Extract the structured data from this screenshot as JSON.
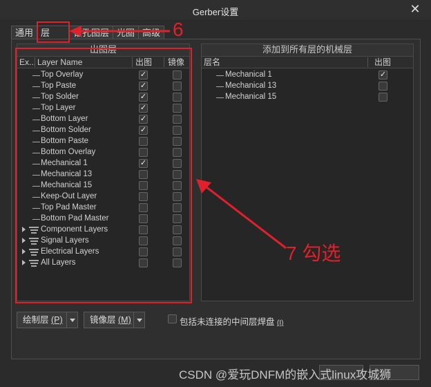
{
  "window": {
    "title": "Gerber设置",
    "close_glyph": "✕"
  },
  "tabs": [
    {
      "label": "通用"
    },
    {
      "label": "层"
    },
    {
      "label": "钻孔图层"
    },
    {
      "label": "光圈"
    },
    {
      "label": "高级"
    }
  ],
  "left_panel": {
    "title": "出图层",
    "headers": {
      "ex": "Ex...",
      "name": "Layer Name",
      "plot": "出图",
      "mirror": "镜像"
    },
    "rows": [
      {
        "name": "Top Overlay",
        "plot": true,
        "mirror": false,
        "kind": "layer"
      },
      {
        "name": "Top Paste",
        "plot": true,
        "mirror": false,
        "kind": "layer"
      },
      {
        "name": "Top Solder",
        "plot": true,
        "mirror": false,
        "kind": "layer"
      },
      {
        "name": "Top Layer",
        "plot": true,
        "mirror": false,
        "kind": "layer"
      },
      {
        "name": "Bottom Layer",
        "plot": true,
        "mirror": false,
        "kind": "layer"
      },
      {
        "name": "Bottom Solder",
        "plot": true,
        "mirror": false,
        "kind": "layer"
      },
      {
        "name": "Bottom Paste",
        "plot": false,
        "mirror": false,
        "kind": "layer"
      },
      {
        "name": "Bottom Overlay",
        "plot": false,
        "mirror": false,
        "kind": "layer"
      },
      {
        "name": "Mechanical 1",
        "plot": true,
        "mirror": false,
        "kind": "layer"
      },
      {
        "name": "Mechanical 13",
        "plot": false,
        "mirror": false,
        "kind": "layer"
      },
      {
        "name": "Mechanical 15",
        "plot": false,
        "mirror": false,
        "kind": "layer"
      },
      {
        "name": "Keep-Out Layer",
        "plot": false,
        "mirror": false,
        "kind": "layer"
      },
      {
        "name": "Top Pad Master",
        "plot": false,
        "mirror": false,
        "kind": "layer"
      },
      {
        "name": "Bottom Pad Master",
        "plot": false,
        "mirror": false,
        "kind": "layer"
      },
      {
        "name": "Component Layers",
        "plot": false,
        "mirror": false,
        "kind": "group"
      },
      {
        "name": "Signal Layers",
        "plot": false,
        "mirror": false,
        "kind": "group"
      },
      {
        "name": "Electrical Layers",
        "plot": false,
        "mirror": false,
        "kind": "group"
      },
      {
        "name": "All Layers",
        "plot": false,
        "mirror": false,
        "kind": "group"
      }
    ]
  },
  "right_panel": {
    "title": "添加到所有层的机械层",
    "headers": {
      "name": "层名",
      "plot": "出图"
    },
    "rows": [
      {
        "name": "Mechanical 1",
        "plot": true
      },
      {
        "name": "Mechanical 13",
        "plot": false
      },
      {
        "name": "Mechanical 15",
        "plot": false
      }
    ]
  },
  "bottom": {
    "plot_layers_button": "绘制层",
    "plot_layers_hotkey": "(P)",
    "mirror_layers_button": "镜像层",
    "mirror_layers_hotkey": "(M)",
    "include_unconnected_label": "包括未连接的中间层焊盘",
    "include_unconnected_hotkey": "(I)",
    "include_unconnected_checked": false
  },
  "annotations": {
    "step6": "6",
    "step7": "7 勾选",
    "color": "#e0202a"
  },
  "watermark": {
    "text": "CSDN @爱玩DNFM的嵌入式linux攻城狮"
  },
  "checkmark_glyph": "✓"
}
